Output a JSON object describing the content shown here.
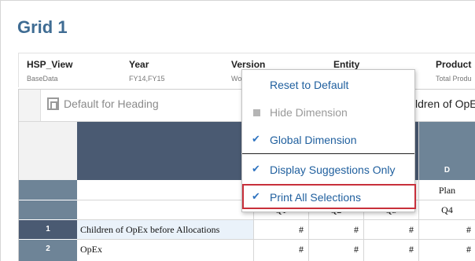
{
  "title": "Grid 1",
  "pov": [
    {
      "name": "HSP_View",
      "value": "BaseData"
    },
    {
      "name": "Year",
      "value": "FY14,FY15"
    },
    {
      "name": "Version",
      "value": "Wo"
    },
    {
      "name": "Entity",
      "value": ""
    },
    {
      "name": "Product",
      "value": "Total Produ"
    }
  ],
  "toolbar": {
    "heading_label": "Default for Heading",
    "member_partial": "ldren of OpE"
  },
  "grid": {
    "col_d_label": "D",
    "header_row1": {
      "col_d": "Plan"
    },
    "header_row2": [
      "Q1",
      "Q2",
      "Q3",
      "Q4"
    ],
    "rows": [
      {
        "num": "1",
        "label": "Children of OpEx before Allocations",
        "values": [
          "#",
          "#",
          "#",
          "#"
        ]
      },
      {
        "num": "2",
        "label": "OpEx",
        "values": [
          "#",
          "#",
          "#",
          "#"
        ]
      }
    ]
  },
  "menu": {
    "items": [
      {
        "label": "Reset to Default",
        "state": "none"
      },
      {
        "label": "Hide Dimension",
        "state": "disabled"
      },
      {
        "label": "Global Dimension",
        "state": "checked"
      },
      {
        "label": "Display Suggestions Only",
        "state": "checked"
      },
      {
        "label": "Print All Selections",
        "state": "checked"
      }
    ],
    "check_glyph": "✔",
    "highlight_color": "#c8303b"
  }
}
